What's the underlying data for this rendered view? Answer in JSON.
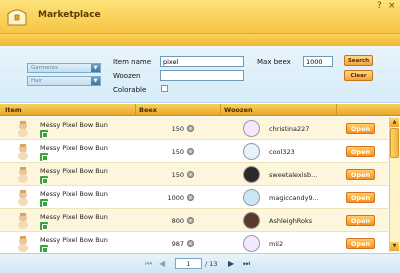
{
  "window": {
    "title": "Marketplace",
    "help": "?",
    "close": "×"
  },
  "filters": {
    "category": "Garments",
    "subcategory": "Hair",
    "item_name_label": "Item name",
    "item_name_value": "pixel",
    "woozen_label": "Woozen",
    "woozen_value": "",
    "colorable_label": "Colorable",
    "max_beex_label": "Max beex",
    "max_beex_value": "1000",
    "search_label": "Search",
    "clear_label": "Clear"
  },
  "table": {
    "columns": [
      "Item",
      "Beex",
      "Woozen"
    ],
    "open_label": "Open",
    "rows": [
      {
        "item": "Messy Pixel Bow Bun",
        "beex": "150",
        "woozen": "christina227"
      },
      {
        "item": "Messy Pixel Bow Bun",
        "beex": "150",
        "woozen": "cool323"
      },
      {
        "item": "Messy Pixel Bow Bun",
        "beex": "150",
        "woozen": "sweetalexisb..."
      },
      {
        "item": "Messy Pixel Bow Bun",
        "beex": "1000",
        "woozen": "magiccandy9..."
      },
      {
        "item": "Messy Pixel Bow Bun",
        "beex": "800",
        "woozen": "AshleighRoks"
      },
      {
        "item": "Messy Pixel Bow Bun",
        "beex": "987",
        "woozen": "mii2"
      }
    ]
  },
  "pagination": {
    "current": "1",
    "total": "/ 13"
  },
  "colors": {
    "title_bar": "#f6c544",
    "panel": "#d6ecf8",
    "accent": "#f79120"
  }
}
